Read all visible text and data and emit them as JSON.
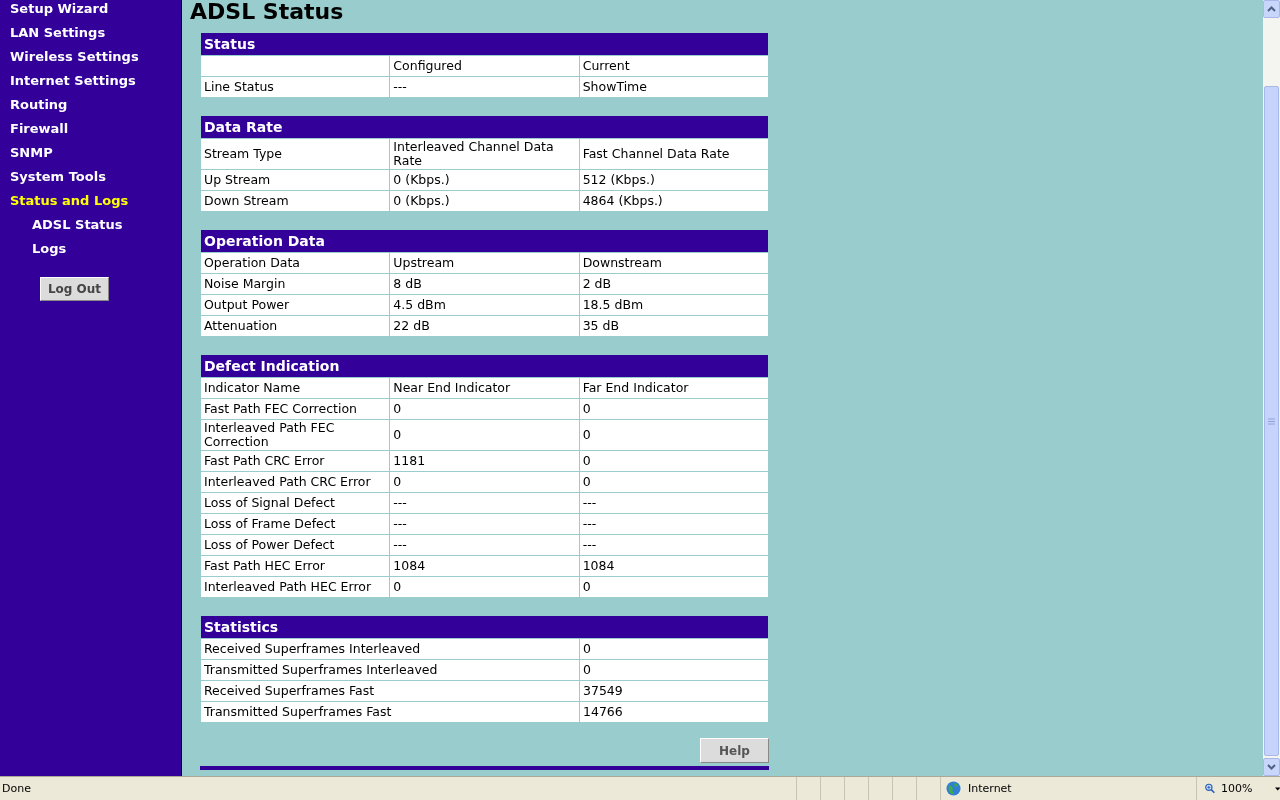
{
  "sidebar": {
    "items": [
      {
        "label": "Setup Wizard",
        "selected": false
      },
      {
        "label": "LAN Settings",
        "selected": false
      },
      {
        "label": "Wireless Settings",
        "selected": false
      },
      {
        "label": "Internet Settings",
        "selected": false
      },
      {
        "label": "Routing",
        "selected": false
      },
      {
        "label": "Firewall",
        "selected": false
      },
      {
        "label": "SNMP",
        "selected": false
      },
      {
        "label": "System Tools",
        "selected": false
      },
      {
        "label": "Status and Logs",
        "selected": true,
        "children": [
          {
            "label": "ADSL Status",
            "selected": false
          },
          {
            "label": "Logs",
            "selected": false
          }
        ]
      }
    ],
    "logout_button": "Log Out"
  },
  "page_title": "ADSL Status",
  "sections": [
    {
      "title": "Status",
      "columns": [
        "",
        "Configured",
        "Current"
      ],
      "rows": [
        [
          "Line Status",
          "---",
          "ShowTime"
        ]
      ]
    },
    {
      "title": "Data Rate",
      "columns": [
        "Stream Type",
        "Interleaved Channel Data Rate",
        "Fast Channel Data Rate"
      ],
      "rows": [
        [
          "Up Stream",
          "0 (Kbps.)",
          "512 (Kbps.)"
        ],
        [
          "Down Stream",
          "0 (Kbps.)",
          "4864 (Kbps.)"
        ]
      ]
    },
    {
      "title": "Operation Data",
      "columns": [
        "Operation Data",
        "Upstream",
        "Downstream"
      ],
      "rows": [
        [
          "Noise Margin",
          "8 dB",
          "2 dB"
        ],
        [
          "Output Power",
          "4.5 dBm",
          "18.5 dBm"
        ],
        [
          "Attenuation",
          "22 dB",
          "35 dB"
        ]
      ]
    },
    {
      "title": "Defect Indication",
      "columns": [
        "Indicator Name",
        "Near End Indicator",
        "Far End Indicator"
      ],
      "rows": [
        [
          "Fast Path FEC Correction",
          "0",
          "0"
        ],
        [
          "Interleaved Path FEC Correction",
          "0",
          "0"
        ],
        [
          "Fast Path CRC Error",
          "1181",
          "0"
        ],
        [
          "Interleaved Path CRC Error",
          "0",
          "0"
        ],
        [
          "Loss of Signal Defect",
          "---",
          "---"
        ],
        [
          "Loss of Frame Defect",
          "---",
          "---"
        ],
        [
          "Loss of Power Defect",
          "---",
          "---"
        ],
        [
          "Fast Path HEC Error",
          "1084",
          "1084"
        ],
        [
          "Interleaved Path HEC Error",
          "0",
          "0"
        ]
      ]
    },
    {
      "title": "Statistics",
      "rows": [
        [
          "Received Superframes Interleaved",
          "0"
        ],
        [
          "Transmitted Superframes Interleaved",
          "0"
        ],
        [
          "Received Superframes Fast",
          "37549"
        ],
        [
          "Transmitted Superframes Fast",
          "14766"
        ]
      ]
    }
  ],
  "help_button": "Help",
  "status_bar": {
    "text": "Done",
    "zone": "Internet",
    "zoom": "100%"
  }
}
